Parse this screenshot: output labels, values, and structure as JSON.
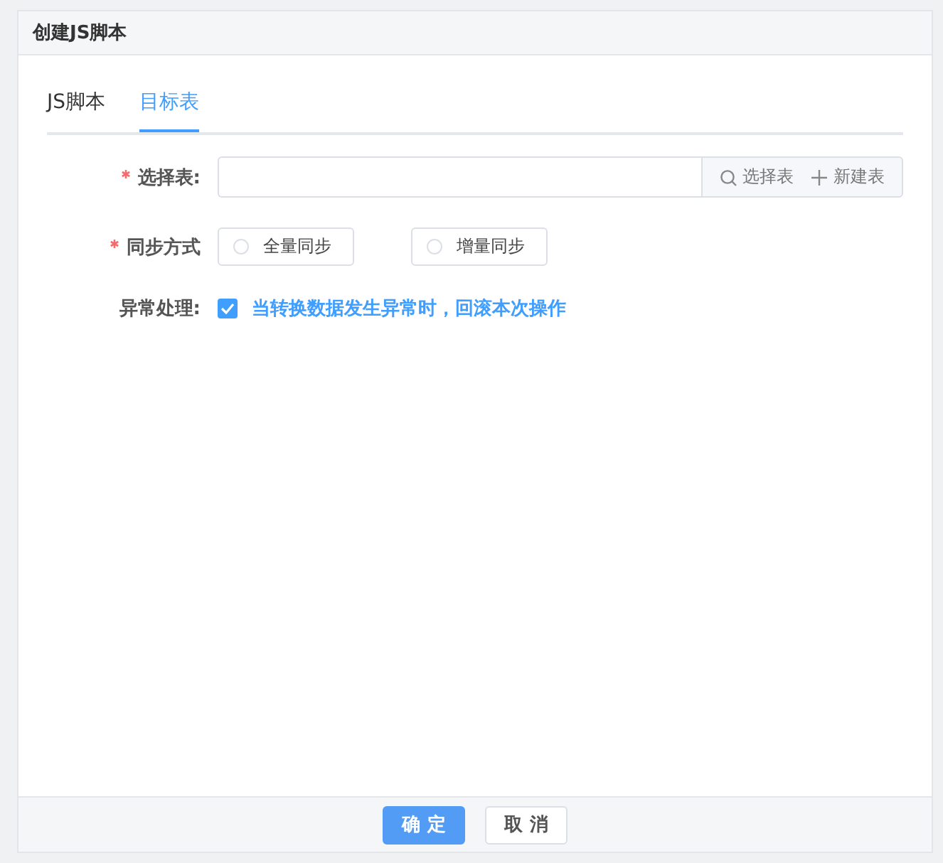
{
  "window": {
    "title": "创建JS脚本"
  },
  "tabs": [
    {
      "label": "JS脚本",
      "selected": false
    },
    {
      "label": "目标表",
      "selected": true
    }
  ],
  "form": {
    "table": {
      "label": "选择表:",
      "required": true,
      "actions": [
        "选择表",
        "新建表"
      ]
    },
    "sync": {
      "label": "同步方式",
      "required": true,
      "options": [
        {
          "label": "全量同步",
          "selected": false
        },
        {
          "label": "增量同步",
          "selected": false
        }
      ]
    },
    "error": {
      "label": "异常处理:",
      "checkbox": {
        "label": "当转换数据发生异常时，回滚本次操作",
        "checked": true
      }
    }
  },
  "buttons": [
    {
      "label": "确 定",
      "kind": "primary"
    },
    {
      "label": "取 消",
      "kind": "default"
    }
  ]
}
